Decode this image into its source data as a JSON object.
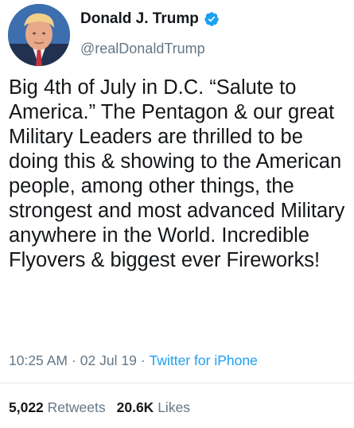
{
  "author": {
    "display_name": "Donald J. Trump",
    "handle": "@realDonaldTrump",
    "verified_icon": "verified-badge-icon",
    "verified_color": "#1da1f2"
  },
  "tweet": {
    "text": "Big 4th of July in D.C. “Salute to America.” The Pentagon & our great Military Leaders are thrilled to be doing this & showing to the American people, among other things, the strongest and most advanced Military anywhere in the World. Incredible Flyovers & biggest ever Fireworks!",
    "time": "10:25 AM",
    "separator": "·",
    "date": "02 Jul 19",
    "source": "Twitter for iPhone"
  },
  "stats": {
    "retweets_count": "5,022",
    "retweets_label": "Retweets",
    "likes_count": "20.6K",
    "likes_label": "Likes"
  },
  "colors": {
    "text": "#14171a",
    "muted": "#657786",
    "link": "#1da1f2",
    "divider": "#e6ecf0"
  }
}
